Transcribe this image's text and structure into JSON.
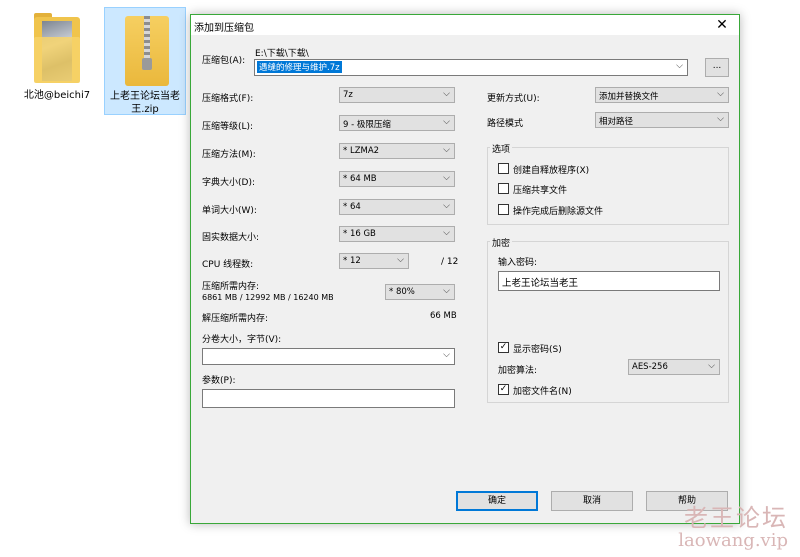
{
  "desktop": {
    "icons": [
      {
        "label": "北池@beichi7"
      },
      {
        "label_line1": "上老王论坛当老",
        "label_line2": "王.zip"
      }
    ]
  },
  "dialog": {
    "title": "添加到压缩包",
    "archive": {
      "label": "压缩包(A):",
      "folder": "E:\\下载\\下载\\",
      "filename": "遇缝的修理与维护.7z",
      "browse": "..."
    },
    "left": {
      "format": {
        "label": "压缩格式(F):",
        "value": "7z"
      },
      "level": {
        "label": "压缩等级(L):",
        "value": "9 - 极限压缩"
      },
      "method": {
        "label": "压缩方法(M):",
        "value": "* LZMA2"
      },
      "dict": {
        "label": "字典大小(D):",
        "value": "* 64 MB"
      },
      "word": {
        "label": "单词大小(W):",
        "value": "* 64"
      },
      "solid": {
        "label": "固实数据大小:",
        "value": "* 16 GB"
      },
      "cpu": {
        "label": "CPU 线程数:",
        "value": "* 12",
        "max": "/ 12"
      },
      "mem_comp": {
        "label": "压缩所需内存:",
        "detail": "6861 MB / 12992 MB / 16240 MB",
        "value": "* 80%"
      },
      "mem_decomp": {
        "label": "解压缩所需内存:",
        "value": "66 MB"
      },
      "split": {
        "label": "分卷大小，字节(V):",
        "value": ""
      },
      "params": {
        "label": "参数(P):",
        "value": ""
      }
    },
    "right": {
      "update": {
        "label": "更新方式(U):",
        "value": "添加并替换文件"
      },
      "path": {
        "label": "路径模式",
        "value": "相对路径"
      },
      "options": {
        "title": "选项",
        "sfx": {
          "label": "创建自释放程序(X)",
          "checked": false
        },
        "shared": {
          "label": "压缩共享文件",
          "checked": false
        },
        "delete": {
          "label": "操作完成后删除源文件",
          "checked": false
        }
      },
      "encryption": {
        "title": "加密",
        "pw_label": "输入密码:",
        "password": "上老王论坛当老王",
        "show": {
          "label": "显示密码(S)",
          "checked": true
        },
        "algo_label": "加密算法:",
        "algo": "AES-256",
        "encnames": {
          "label": "加密文件名(N)",
          "checked": true
        }
      }
    },
    "buttons": {
      "ok": "确定",
      "cancel": "取消",
      "help": "帮助"
    }
  },
  "watermark": {
    "cn": "老王论坛",
    "url": "laowang.vip"
  },
  "colors": {
    "selection": "#0078d7",
    "dialog_border": "#39a839",
    "watermark": "#d9b6b6"
  }
}
